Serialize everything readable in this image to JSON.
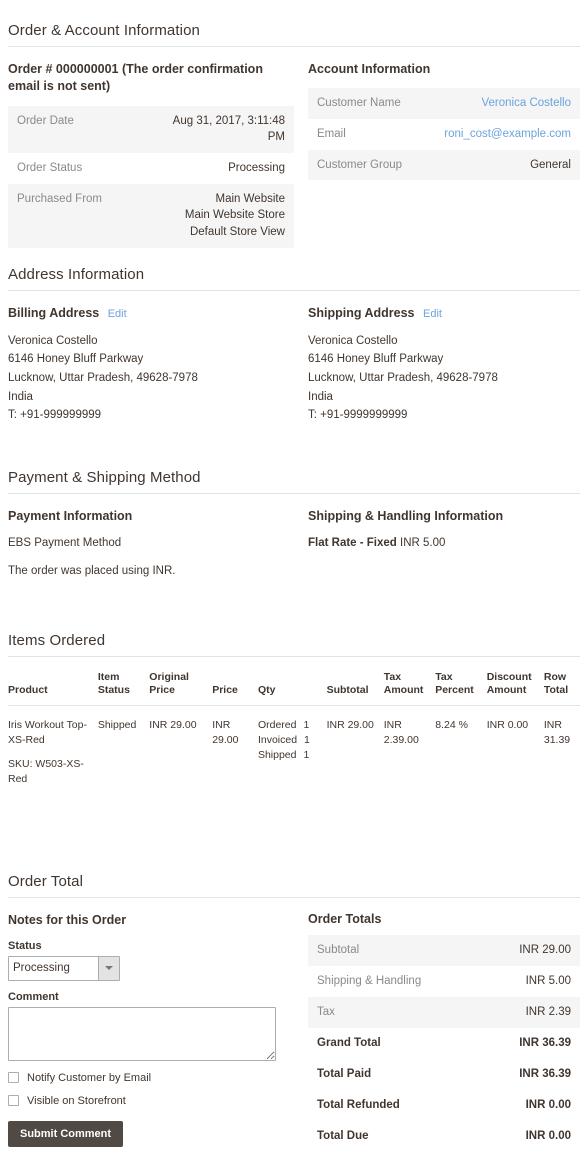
{
  "sections": {
    "order_account": "Order & Account Information",
    "address": "Address Information",
    "payment_shipping": "Payment & Shipping Method",
    "items_ordered": "Items Ordered",
    "order_total": "Order Total"
  },
  "order": {
    "heading": "Order # 000000001 (The order confirmation email is not sent)",
    "rows": [
      {
        "label": "Order Date",
        "value": "Aug 31, 2017, 3:11:48 PM"
      },
      {
        "label": "Order Status",
        "value": "Processing"
      }
    ],
    "purchased_from_label": "Purchased From",
    "purchased_from_lines": [
      "Main Website",
      "Main Website Store",
      "Default Store View"
    ]
  },
  "account": {
    "title": "Account Information",
    "customer_name_label": "Customer Name",
    "customer_name": "Veronica Costello",
    "email_label": "Email",
    "email": "roni_cost@example.com",
    "customer_group_label": "Customer Group",
    "customer_group": "General"
  },
  "billing": {
    "title": "Billing Address",
    "edit": "Edit",
    "lines": [
      "Veronica Costello",
      "6146 Honey Bluff Parkway",
      "Lucknow, Uttar Pradesh, 49628-7978",
      "India",
      "T: +91-999999999"
    ]
  },
  "shipping_address": {
    "title": "Shipping Address",
    "edit": "Edit",
    "lines": [
      "Veronica Costello",
      "6146 Honey Bluff Parkway",
      "Lucknow, Uttar Pradesh, 49628-7978",
      "India",
      "T: +91-9999999999"
    ]
  },
  "payment": {
    "title": "Payment Information",
    "method": "EBS Payment Method",
    "currency_note": "The order was placed using INR."
  },
  "shipping_method": {
    "title": "Shipping & Handling Information",
    "name": "Flat Rate - Fixed",
    "price": "INR 5.00"
  },
  "items": {
    "headers": [
      "Product",
      "Item\nStatus",
      "Original\nPrice",
      "Price",
      "Qty",
      "Subtotal",
      "Tax\nAmount",
      "Tax\nPercent",
      "Discount\nAmount",
      "Row\nTotal"
    ],
    "rows": [
      {
        "product_name": "Iris Workout Top-XS-Red",
        "sku": "SKU: W503-XS-Red",
        "item_status": "Shipped",
        "original_price": "INR 29.00",
        "price": "INR 29.00",
        "qty": [
          {
            "label": "Ordered",
            "count": "1"
          },
          {
            "label": "Invoiced",
            "count": "1"
          },
          {
            "label": "Shipped",
            "count": "1"
          }
        ],
        "subtotal": "INR 29.00",
        "tax_amount": "INR 2.39.00",
        "tax_percent": "8.24 %",
        "discount_amount": "INR 0.00",
        "row_total": "INR 31.39"
      }
    ]
  },
  "notes": {
    "title": "Notes for this Order",
    "status_label": "Status",
    "status_value": "Processing",
    "status_options": [
      "Processing"
    ],
    "comment_label": "Comment",
    "comment_value": "",
    "comment_placeholder": "",
    "notify_label": "Notify Customer by Email",
    "visible_label": "Visible on Storefront",
    "submit_label": "Submit Comment"
  },
  "totals": {
    "title": "Order Totals",
    "rows": [
      {
        "label": "Subtotal",
        "value": "INR 29.00",
        "strong": false
      },
      {
        "label": "Shipping & Handling",
        "value": "INR 5.00",
        "strong": false
      },
      {
        "label": "Tax",
        "value": "INR 2.39",
        "strong": false
      },
      {
        "label": "Grand Total",
        "value": "INR 36.39",
        "strong": true
      },
      {
        "label": "Total Paid",
        "value": "INR 36.39",
        "strong": true
      },
      {
        "label": "Total Refunded",
        "value": "INR 0.00",
        "strong": true
      },
      {
        "label": "Total Due",
        "value": "INR 0.00",
        "strong": true
      }
    ]
  },
  "colors": {
    "link": "#6ca3dd",
    "heading": "#41362f",
    "muted": "#8a8a8a",
    "row_shade": "#f5f5f5",
    "button": "#514943"
  }
}
